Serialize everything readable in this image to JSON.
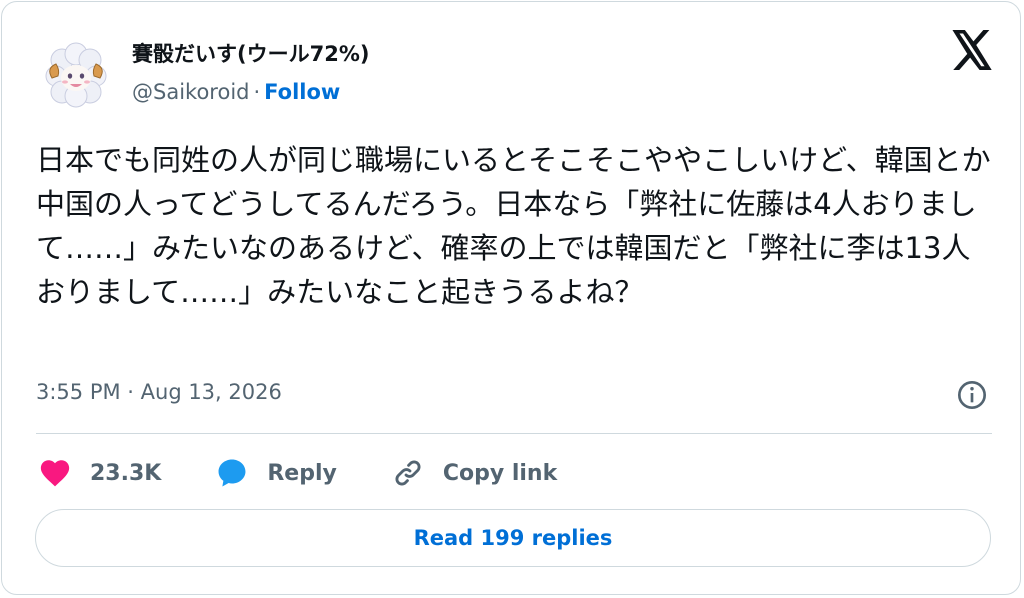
{
  "author": {
    "display_name": "賽骰だいす(ウール72%)",
    "handle": "@Saikoroid",
    "separator": "·",
    "follow_label": "Follow",
    "avatar_icon": "fluffy-creature-avatar"
  },
  "brand": {
    "logo_icon": "x-logo-icon"
  },
  "tweet": {
    "text": "日本でも同姓の人が同じ職場にいるとそこそこややこしいけど、韓国とか中国の人ってどうしてるんだろう。日本なら「弊社に佐藤は4人おりまして……」みたいなのあるけど、確率の上では韓国だと「弊社に李は13人おりまして……」みたいなこと起きうるよね？",
    "timestamp": "3:55 PM · Aug 13, 2026"
  },
  "actions": {
    "like_count": "23.3K",
    "reply_label": "Reply",
    "copy_link_label": "Copy link"
  },
  "footer": {
    "read_replies_label": "Read 199 replies"
  },
  "colors": {
    "link_blue": "#006fd6",
    "like_red": "#f91880",
    "reply_blue": "#1d9bf0",
    "muted_gray": "#536471",
    "border": "#cfd9de"
  }
}
